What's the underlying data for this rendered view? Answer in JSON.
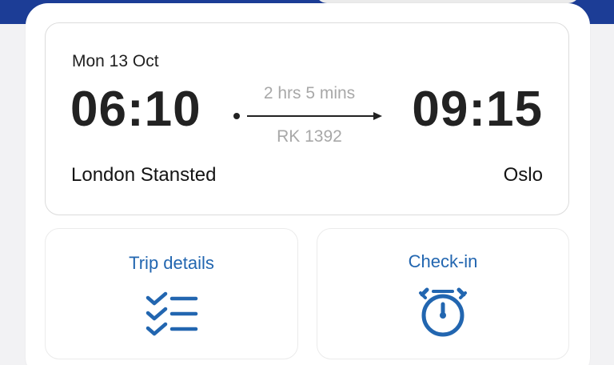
{
  "flight": {
    "date": "Mon 13 Oct",
    "departure_time": "06:10",
    "arrival_time": "09:15",
    "duration": "2 hrs 5 mins",
    "flight_number": "RK 1392",
    "departure_city": "London Stansted",
    "arrival_city": "Oslo"
  },
  "actions": {
    "trip_details_label": "Trip details",
    "trip_details_icon": "checklist-icon",
    "check_in_label": "Check-in",
    "check_in_icon": "stopwatch-icon"
  },
  "colors": {
    "brand_blue": "#1c3d96",
    "link_blue": "#2266b0",
    "muted_text": "#a8a8a8"
  }
}
